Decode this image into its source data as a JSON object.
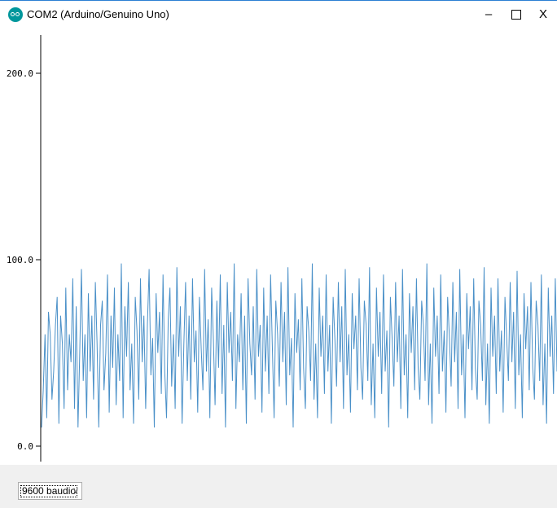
{
  "window": {
    "title": "COM2 (Arduino/Genuino Uno)",
    "icon": "arduino-icon",
    "buttons": {
      "minimize": "–",
      "maximize": "☐",
      "close": "X"
    }
  },
  "plotter": {
    "y_ticks": [
      "200.0",
      "100.0",
      "0.0"
    ],
    "line_color": "#4a90c8"
  },
  "chart_data": {
    "type": "line",
    "ylim": [
      0,
      200
    ],
    "series": [
      {
        "values": [
          10,
          30,
          60,
          15,
          72,
          60,
          25,
          40,
          65,
          80,
          12,
          70,
          55,
          20,
          85,
          30,
          60,
          45,
          90,
          20,
          75,
          10,
          50,
          95,
          35,
          60,
          15,
          82,
          40,
          70,
          25,
          88,
          55,
          10,
          65,
          78,
          30,
          50,
          92,
          18,
          70,
          42,
          85,
          22,
          60,
          35,
          98,
          15,
          75,
          48,
          88,
          30,
          55,
          12,
          80,
          62,
          25,
          90,
          45,
          70,
          20,
          65,
          95,
          38,
          58,
          10,
          82,
          50,
          72,
          28,
          92,
          40,
          15,
          68,
          85,
          32,
          60,
          20,
          96,
          48,
          75,
          12,
          55,
          88,
          35,
          70,
          25,
          90,
          45,
          62,
          18,
          80,
          52,
          30,
          95,
          40,
          68,
          15,
          85,
          58,
          22,
          78,
          42,
          92,
          28,
          65,
          10,
          88,
          50,
          72,
          35,
          98,
          20,
          60,
          45,
          82,
          30,
          70,
          12,
          90,
          55,
          38,
          75,
          25,
          95,
          48,
          65,
          18,
          85,
          40,
          70,
          28,
          92,
          52,
          15,
          78,
          60,
          32,
          88,
          45,
          72,
          22,
          96,
          38,
          58,
          10,
          82,
          50,
          68,
          30,
          90,
          42,
          20,
          75,
          62,
          35,
          98,
          25,
          55,
          15,
          85,
          48,
          70,
          28,
          92,
          40,
          65,
          12,
          80,
          58,
          32,
          88,
          45,
          75,
          20,
          95,
          38,
          60,
          18,
          82,
          52,
          70,
          30,
          90,
          42,
          25,
          78,
          65,
          35,
          96,
          22,
          55,
          15,
          85,
          48,
          72,
          28,
          92,
          40,
          62,
          10,
          80,
          58,
          32,
          88,
          45,
          70,
          20,
          95,
          38,
          60,
          15,
          82,
          50,
          75,
          30,
          90,
          42,
          25,
          78,
          65,
          35,
          98,
          22,
          55,
          12,
          85,
          48,
          70,
          28,
          92,
          40,
          62,
          18,
          80,
          58,
          32,
          88,
          45,
          72,
          20,
          95,
          38,
          60,
          15,
          82,
          52,
          75,
          30,
          90,
          42,
          25,
          78,
          65,
          35,
          96,
          22,
          55,
          12,
          85,
          48,
          70,
          28,
          90,
          40,
          62,
          18,
          80,
          58,
          35,
          88,
          45,
          72,
          20,
          94,
          38,
          60,
          15,
          82,
          52,
          75,
          30,
          88,
          42,
          25,
          78,
          65,
          35,
          92,
          22,
          55,
          12,
          85,
          48,
          70,
          28,
          90,
          40
        ]
      }
    ]
  },
  "footer": {
    "baud_select": {
      "value": "9600 baudio",
      "arrow": "∨"
    }
  }
}
